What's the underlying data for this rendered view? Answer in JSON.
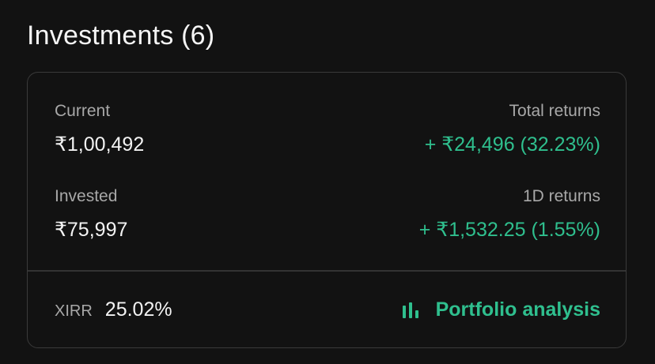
{
  "header": {
    "title": "Investments (6)"
  },
  "summary": {
    "current_label": "Current",
    "current_value": "₹1,00,492",
    "total_returns_label": "Total returns",
    "total_returns_value": "+ ₹24,496 (32.23%)",
    "invested_label": "Invested",
    "invested_value": "₹75,997",
    "day_returns_label": "1D returns",
    "day_returns_value": "+ ₹1,532.25 (1.55%)"
  },
  "footer": {
    "xirr_label": "XIRR",
    "xirr_value": "25.02%",
    "analysis_label": "Portfolio analysis",
    "analysis_icon": "bar-chart-icon"
  },
  "colors": {
    "background": "#121212",
    "border": "#3a3a3a",
    "positive": "#2fbf8e",
    "muted": "#a8a8a8",
    "text": "#f3f3f3"
  }
}
